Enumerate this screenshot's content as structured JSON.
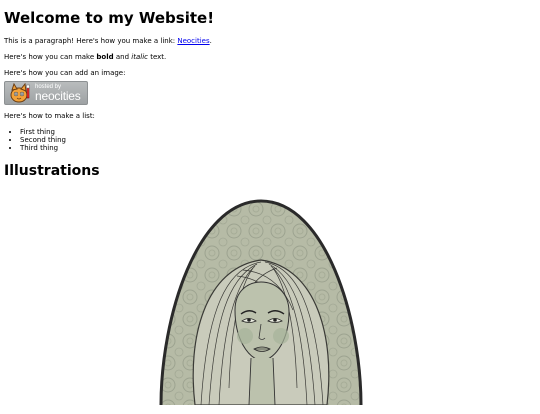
{
  "page": {
    "title": "Welcome to my Website!",
    "intro": {
      "prefix": "This is a paragraph! Here's how you make a link: ",
      "link_text": "Neocities",
      "suffix": "."
    },
    "formatting": {
      "prefix": "Here's how you can make ",
      "bold": "bold",
      "middle": " and ",
      "italic": "italic",
      "suffix": " text."
    },
    "image_text": "Here's how you can add an image:",
    "badge": {
      "small": "hosted by",
      "big": "neocities",
      "icon": "neocities-cat-icon"
    },
    "list_text": "Here's how to make a list:",
    "list_items": [
      "First thing",
      "Second thing",
      "Third thing"
    ],
    "section_heading": "Illustrations",
    "illustration": {
      "icon": "portrait-illustration"
    }
  },
  "colors": {
    "link": "#0000ee",
    "badge_bg": "#a9adaf",
    "illustration_bg": "#b6bba6",
    "illustration_frame": "#2a2a2a"
  }
}
